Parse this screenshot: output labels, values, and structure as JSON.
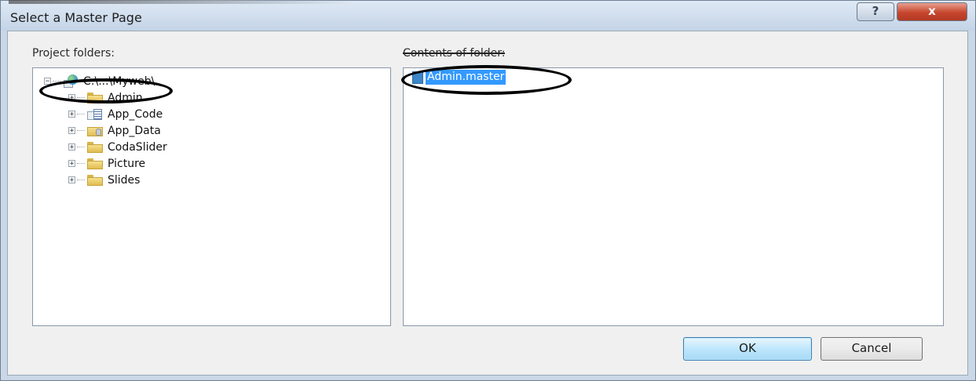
{
  "dialog": {
    "title": "Select a Master Page",
    "help_label": "?",
    "close_label": "x"
  },
  "project": {
    "label": "Project folders:",
    "tree": [
      {
        "label": "C:\\...\\Myweb\\",
        "icon": "website-icon",
        "expander": "−"
      },
      {
        "label": "Admin",
        "icon": "folder-icon",
        "expander": "+"
      },
      {
        "label": "App_Code",
        "icon": "code-folder-icon",
        "expander": "+"
      },
      {
        "label": "App_Data",
        "icon": "data-folder-icon",
        "expander": "+"
      },
      {
        "label": "CodaSlider",
        "icon": "folder-icon",
        "expander": "+"
      },
      {
        "label": "Picture",
        "icon": "folder-icon",
        "expander": "+"
      },
      {
        "label": "Slides",
        "icon": "folder-icon",
        "expander": "+"
      }
    ]
  },
  "contents": {
    "label": "Contents of folder:",
    "files": [
      {
        "label": "Admin.master",
        "selected": true
      }
    ]
  },
  "buttons": {
    "ok": "OK",
    "cancel": "Cancel"
  },
  "colors": {
    "selection": "#3399ff",
    "annotation_ring": "#000000",
    "close_button": "#c6452d"
  }
}
